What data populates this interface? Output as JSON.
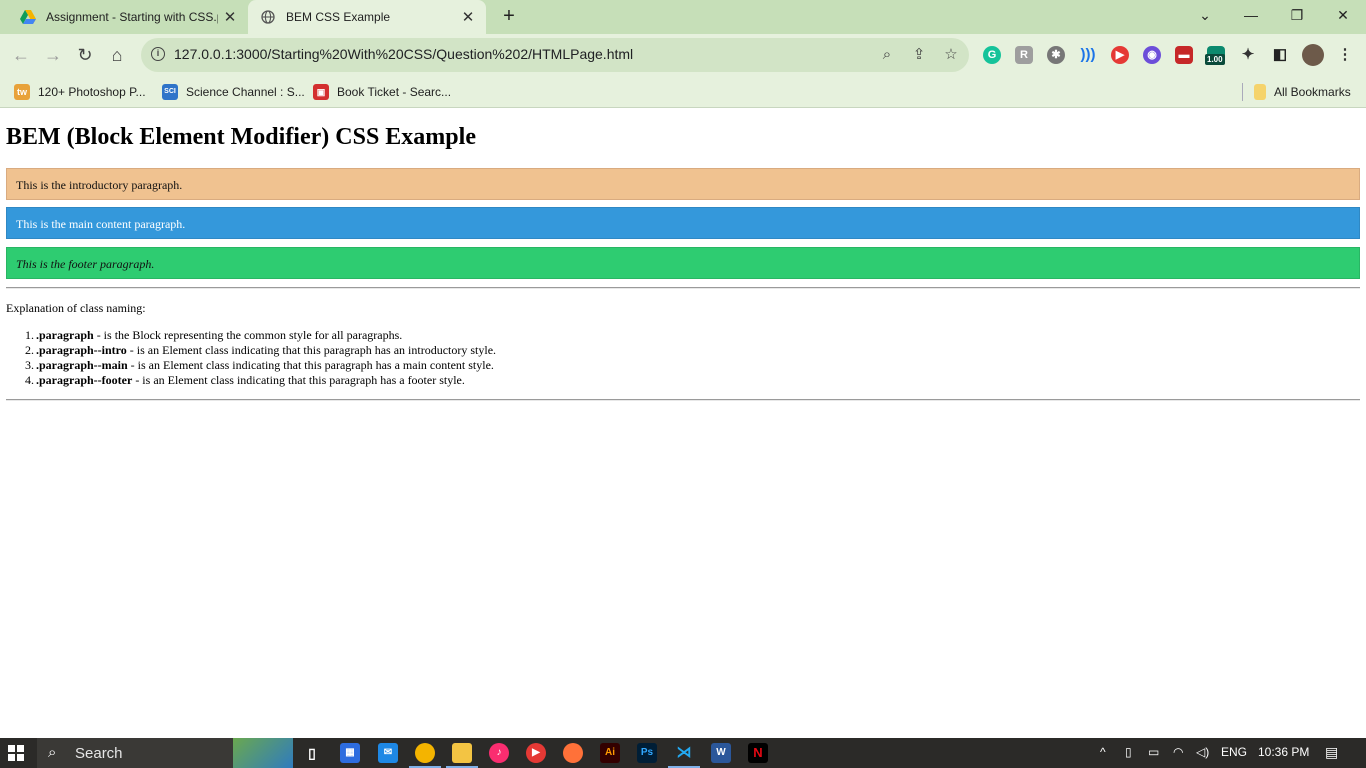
{
  "browser": {
    "tabs": [
      {
        "title": "Assignment - Starting with CSS.p",
        "active": false,
        "icon": "google-drive-icon"
      },
      {
        "title": "BEM CSS Example",
        "active": true,
        "icon": "globe-icon"
      }
    ],
    "url": "127.0.0.1:3000/Starting%20With%20CSS/Question%202/HTMLPage.html",
    "extension_badge": "1.00",
    "bookmarks": [
      {
        "label": "120+ Photoshop P...",
        "icon": "tw-icon",
        "icon_text": "tw",
        "color": "#e8a23a"
      },
      {
        "label": "Science Channel : S...",
        "icon": "sci-icon",
        "icon_text": "SCI",
        "color": "#2f74c9"
      },
      {
        "label": "Book Ticket - Searc...",
        "icon": "bus-icon",
        "icon_text": "",
        "color": "#d32f2f"
      }
    ],
    "all_bookmarks": "All Bookmarks"
  },
  "page": {
    "title": "BEM (Block Element Modifier) CSS Example",
    "paragraphs": {
      "intro": "This is the introductory paragraph.",
      "main": "This is the main content paragraph.",
      "footer": "This is the footer paragraph."
    },
    "explanation": "Explanation of class naming:",
    "items": [
      {
        "num": "1.",
        "cls": ".paragraph",
        "text": " - is the Block representing the common style for all paragraphs."
      },
      {
        "num": "2.",
        "cls": ".paragraph--intro",
        "text": " - is an Element class indicating that this paragraph has an introductory style."
      },
      {
        "num": "3.",
        "cls": ".paragraph--main",
        "text": " - is an Element class indicating that this paragraph has a main content style."
      },
      {
        "num": "4.",
        "cls": ".paragraph--footer",
        "text": " - is an Element class indicating that this paragraph has a footer style."
      }
    ],
    "colors": {
      "intro": "#f0c290",
      "main": "#3498db",
      "footer": "#2ecc71"
    }
  },
  "taskbar": {
    "search_label": "Search",
    "language": "ENG",
    "time": "10:36 PM"
  }
}
